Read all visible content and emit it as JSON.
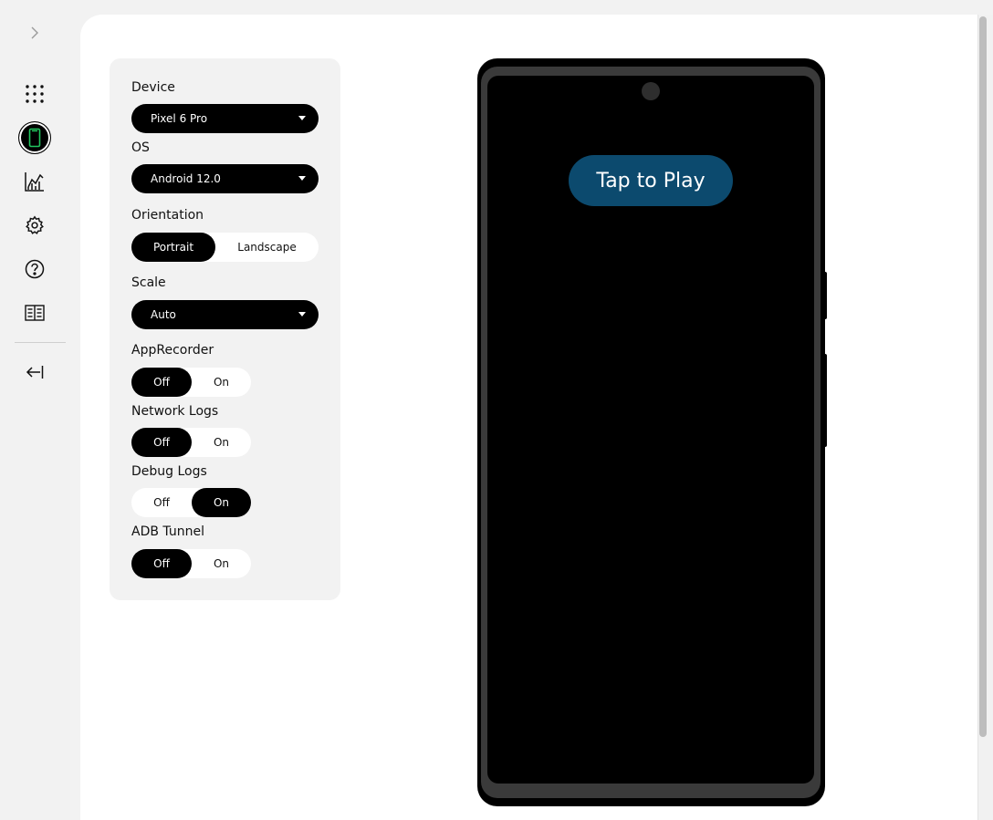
{
  "sidebar": {
    "items": [
      {
        "icon": "apps-grid-icon"
      },
      {
        "icon": "device-icon",
        "active": true
      },
      {
        "icon": "chart-icon"
      },
      {
        "icon": "gear-icon"
      },
      {
        "icon": "help-icon"
      },
      {
        "icon": "book-icon"
      }
    ],
    "collapse_icon": "collapse-left-icon",
    "expand_icon": "chevron-right-icon"
  },
  "settings": {
    "device": {
      "label": "Device",
      "value": "Pixel 6 Pro"
    },
    "os": {
      "label": "OS",
      "value": "Android 12.0"
    },
    "orientation": {
      "label": "Orientation",
      "options": [
        "Portrait",
        "Landscape"
      ],
      "selected": "Portrait"
    },
    "scale": {
      "label": "Scale",
      "value": "Auto"
    },
    "app_recorder": {
      "label": "AppRecorder",
      "off": "Off",
      "on": "On",
      "selected": "Off"
    },
    "network_logs": {
      "label": "Network Logs",
      "off": "Off",
      "on": "On",
      "selected": "Off"
    },
    "debug_logs": {
      "label": "Debug Logs",
      "off": "Off",
      "on": "On",
      "selected": "On"
    },
    "adb_tunnel": {
      "label": "ADB Tunnel",
      "off": "Off",
      "on": "On",
      "selected": "Off"
    }
  },
  "phone": {
    "play_button": "Tap to Play"
  },
  "colors": {
    "accent": "#0c4a6e",
    "rail_active_icon": "#22c55e",
    "background": "#f2f2f2"
  }
}
